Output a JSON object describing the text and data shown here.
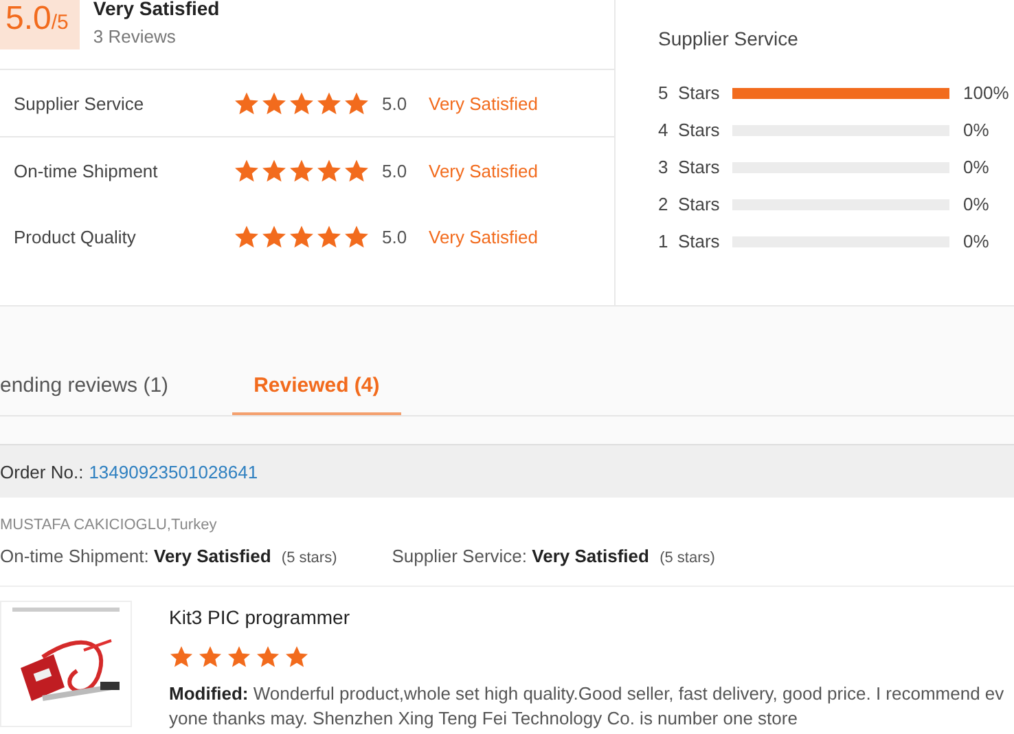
{
  "summary": {
    "score": "5.0",
    "out_of": "/5",
    "verdict": "Very Satisfied",
    "reviews": "3 Reviews"
  },
  "ratings": [
    {
      "label": "Supplier Service",
      "stars": 5,
      "score": "5.0",
      "verdict": "Very Satisfied"
    },
    {
      "label": "On-time Shipment",
      "stars": 5,
      "score": "5.0",
      "verdict": "Very Satisfied"
    },
    {
      "label": "Product Quality",
      "stars": 5,
      "score": "5.0",
      "verdict": "Very Satisfied"
    }
  ],
  "distribution": {
    "title": "Supplier Service",
    "rows": [
      {
        "label": "5  Stars",
        "level": 1,
        "percent": "100%"
      },
      {
        "label": "4  Stars",
        "level": 0,
        "percent": "0%"
      },
      {
        "label": "3  Stars",
        "level": 0,
        "percent": "0%"
      },
      {
        "label": "2  Stars",
        "level": 0,
        "percent": "0%"
      },
      {
        "label": "1  Stars",
        "level": 0,
        "percent": "0%"
      }
    ]
  },
  "tabs": [
    {
      "label": "ending reviews (1)",
      "selected": false
    },
    {
      "label": "Reviewed (4)",
      "selected": true
    }
  ],
  "order": {
    "label": "Order No.:",
    "number": "13490923501028641"
  },
  "review": {
    "buyer": "MUSTAFA CAKICIOGLU,Turkey",
    "ratings": [
      {
        "label": "On-time Shipment:",
        "verdict": "Very Satisfied",
        "stars": "(5 stars)"
      },
      {
        "label": "Supplier Service:",
        "verdict": "Very Satisfied",
        "stars": "(5 stars)"
      }
    ],
    "product": {
      "kind": "picture",
      "title": "Kit3 PIC programmer",
      "stars": 5,
      "comment_lines": [
        "**Modified:** Wonderful product,whole set  high quality.Good seller, fast delivery, good price. I recommend ev",
        "yone  thanks may. Shenzhen Xing Teng Fei Technology Co. is number one store"
      ]
    }
  }
}
